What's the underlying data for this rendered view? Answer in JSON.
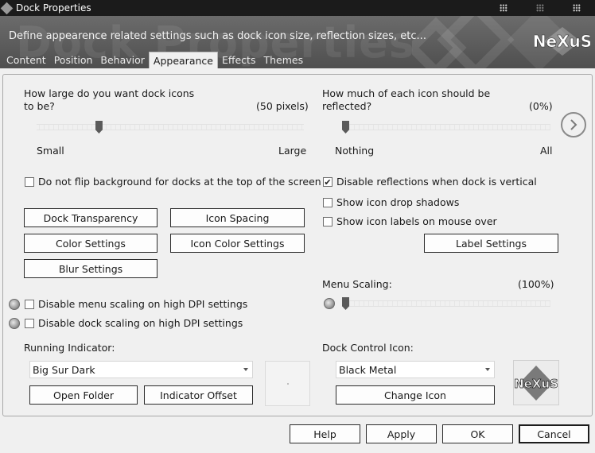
{
  "window": {
    "title": "Dock Properties",
    "icon": "diamond-app-icon"
  },
  "banner": {
    "subtitle": "Define appearence related settings such as dock icon size, reflection sizes, etc...",
    "watermark": "Dock Properties",
    "logo_text": "NeXuS"
  },
  "tabs": [
    {
      "label": "Content"
    },
    {
      "label": "Position"
    },
    {
      "label": "Behavior"
    },
    {
      "label": "Appearance",
      "active": true
    },
    {
      "label": "Effects"
    },
    {
      "label": "Themes"
    }
  ],
  "icon_size": {
    "question": "How large do you want dock icons to be?",
    "question_line1": "How large do you want dock icons",
    "question_line2": "to be?",
    "value_text": "(50 pixels)",
    "value": 50,
    "min_label": "Small",
    "max_label": "Large",
    "level": 0.22
  },
  "reflection": {
    "question_line1": "How much of each icon should be",
    "question_line2": "reflected?",
    "value_text": "(0%)",
    "value": 0,
    "min_label": "Nothing",
    "max_label": "All",
    "level": 0.0
  },
  "checkboxes": {
    "no_flip": {
      "label": "Do not flip background for docks at the top of the screen",
      "checked": false
    },
    "disable_reflections_vertical": {
      "label": "Disable reflections when dock is vertical",
      "checked": true
    },
    "drop_shadows": {
      "label": "Show icon drop shadows",
      "checked": false
    },
    "icon_labels": {
      "label": "Show icon labels on mouse over",
      "checked": false
    },
    "menu_dpi": {
      "label": "Disable menu scaling on high DPI settings",
      "checked": false
    },
    "dock_dpi": {
      "label": "Disable dock scaling on high DPI settings",
      "checked": false
    }
  },
  "buttons": {
    "dock_transparency": "Dock Transparency",
    "icon_spacing": "Icon Spacing",
    "color_settings": "Color Settings",
    "icon_color_settings": "Icon Color Settings",
    "blur_settings": "Blur Settings",
    "label_settings": "Label Settings",
    "open_folder": "Open Folder",
    "indicator_offset": "Indicator Offset",
    "change_icon": "Change Icon"
  },
  "menu_scaling": {
    "label": "Menu Scaling:",
    "value_text": "(100%)",
    "value": 100,
    "level": 0.0
  },
  "running_indicator": {
    "label": "Running Indicator:",
    "selected": "Big Sur Dark"
  },
  "dock_control_icon": {
    "label": "Dock Control Icon:",
    "selected": "Black Metal",
    "icon_text": "NeXuS"
  },
  "footer": {
    "help": "Help",
    "apply": "Apply",
    "ok": "OK",
    "cancel": "Cancel"
  }
}
